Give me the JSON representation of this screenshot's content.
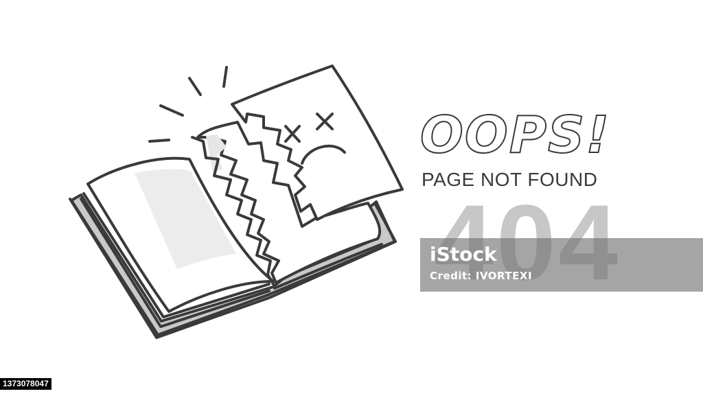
{
  "headline": "OOPS!",
  "subtitle": "PAGE NOT FOUND",
  "error_code": "404",
  "watermark": {
    "logo": "iStock",
    "credit": "Credit: IVORTEXI"
  },
  "image_id": "1373078047",
  "colors": {
    "line": "#3a3a3a",
    "shadow": "#c9c9c9",
    "code": "#c7c7c7",
    "page": "#ffffff",
    "watermark_band": "#6e6e6e"
  },
  "icons": [
    "torn-book-icon",
    "dizzy-sad-face-icon",
    "shock-lines-icon"
  ]
}
